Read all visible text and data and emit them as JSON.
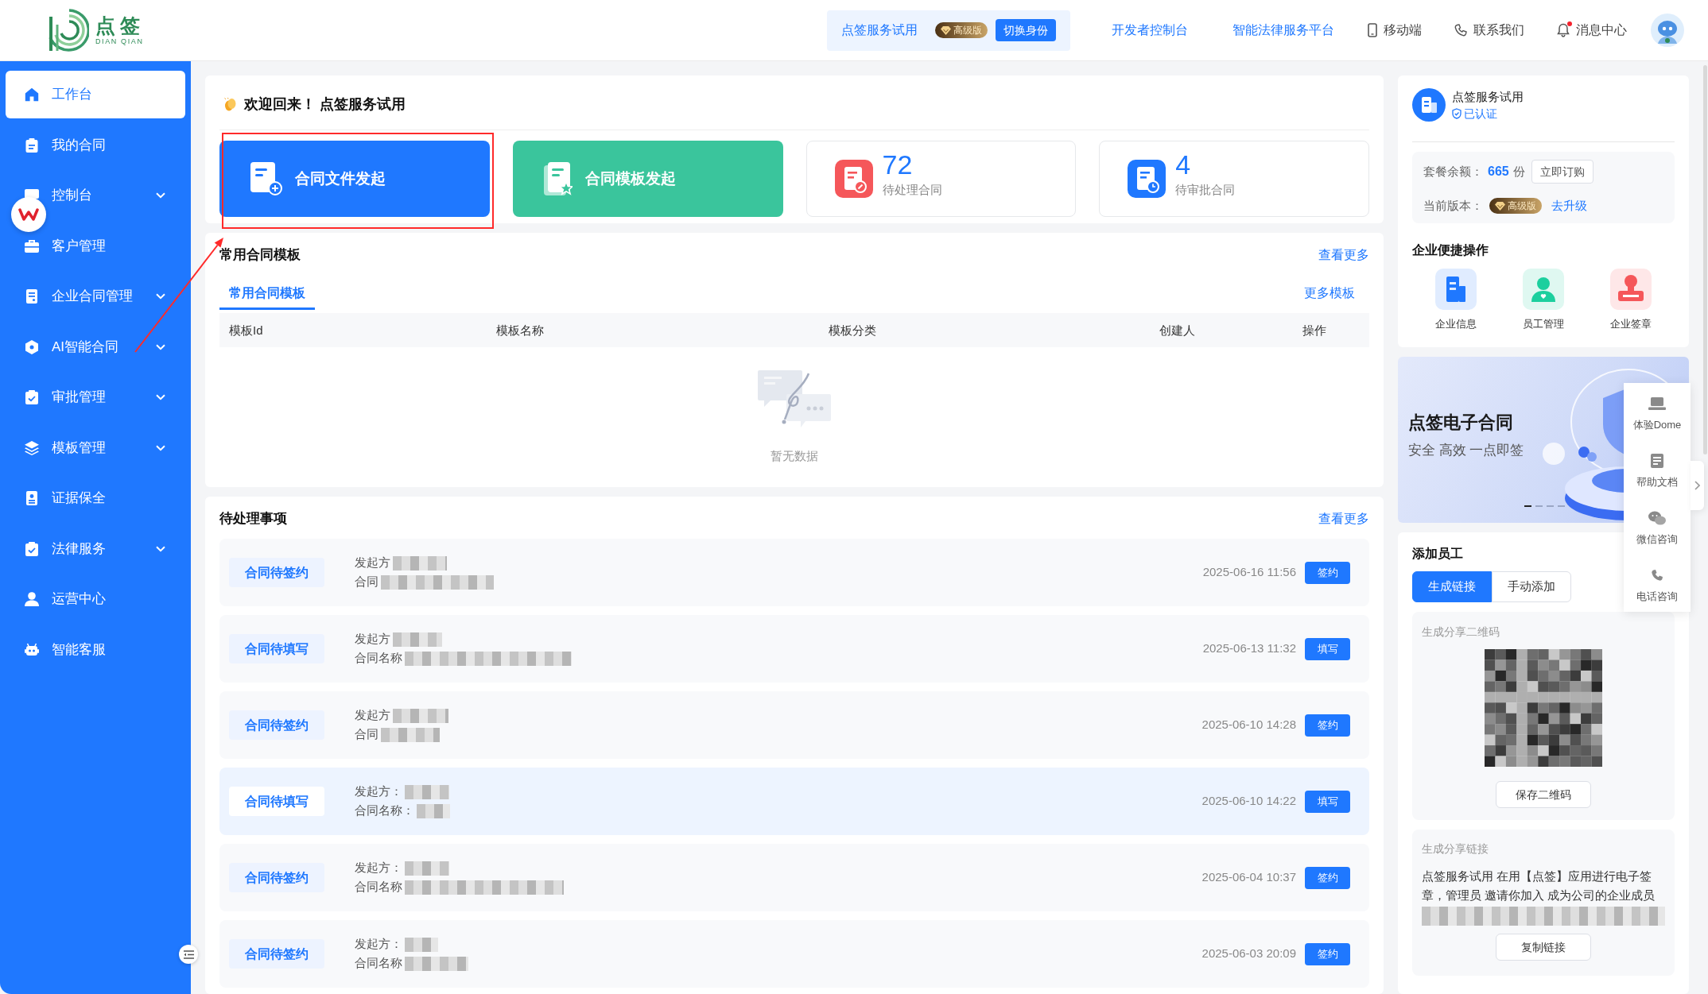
{
  "header": {
    "logo": {
      "name": "点签",
      "subtitle": "DIAN QIAN"
    },
    "identity": {
      "name": "点签服务试用",
      "badge": "高级版",
      "button": "切换身份"
    },
    "links": [
      "开发者控制台",
      "智能法律服务平台"
    ],
    "tools": [
      {
        "label": "移动端",
        "unread": false
      },
      {
        "label": "联系我们",
        "unread": false
      },
      {
        "label": "消息中心",
        "unread": true
      }
    ]
  },
  "sidebar": {
    "items": [
      {
        "label": "工作台",
        "selected": true,
        "expandable": false
      },
      {
        "label": "我的合同",
        "selected": false,
        "expandable": false
      },
      {
        "label": "控制台",
        "selected": false,
        "expandable": true
      },
      {
        "label": "客户管理",
        "selected": false,
        "expandable": false
      },
      {
        "label": "企业合同管理",
        "selected": false,
        "expandable": true
      },
      {
        "label": "AI智能合同",
        "selected": false,
        "expandable": true
      },
      {
        "label": "审批管理",
        "selected": false,
        "expandable": true
      },
      {
        "label": "模板管理",
        "selected": false,
        "expandable": true
      },
      {
        "label": "证据保全",
        "selected": false,
        "expandable": false
      },
      {
        "label": "法律服务",
        "selected": false,
        "expandable": true
      },
      {
        "label": "运营中心",
        "selected": false,
        "expandable": false
      },
      {
        "label": "智能客服",
        "selected": false,
        "expandable": false
      }
    ]
  },
  "welcome": {
    "title": "欢迎回来！ 点签服务试用",
    "actions": [
      {
        "label": "合同文件发起",
        "color": "#1f78ff"
      },
      {
        "label": "合同模板发起",
        "color": "#3ac59c"
      }
    ],
    "stats": [
      {
        "value": "72",
        "label": "待处理合同",
        "color": "#f5575a"
      },
      {
        "value": "4",
        "label": "待审批合同",
        "color": "#1f78ff"
      }
    ]
  },
  "templates": {
    "title": "常用合同模板",
    "more": "查看更多",
    "tabs": [
      {
        "label": "常用合同模板",
        "selected": true
      }
    ],
    "more_templates": "更多模板",
    "columns": [
      "模板Id",
      "模板名称",
      "模板分类",
      "创建人",
      "操作"
    ],
    "empty_text": "暂无数据"
  },
  "pending": {
    "title": "待处理事项",
    "more": "查看更多",
    "rows": [
      {
        "status": "合同待签约",
        "initiator": "发起方",
        "contract": "合同",
        "time": "2025-06-16 11:56",
        "action": "签约",
        "highlighted": false
      },
      {
        "status": "合同待填写",
        "initiator": "发起方",
        "contract": "合同名称",
        "time": "2025-06-13 11:32",
        "action": "填写",
        "highlighted": false
      },
      {
        "status": "合同待签约",
        "initiator": "发起方",
        "contract": "合同",
        "time": "2025-06-10 14:28",
        "action": "签约",
        "highlighted": false
      },
      {
        "status": "合同待填写",
        "initiator": "发起方：",
        "contract": "合同名称：",
        "time": "2025-06-10 14:22",
        "action": "填写",
        "highlighted": true
      },
      {
        "status": "合同待签约",
        "initiator": "发起方：",
        "contract": "合同名称",
        "time": "2025-06-04 10:37",
        "action": "签约",
        "highlighted": false
      },
      {
        "status": "合同待签约",
        "initiator": "发起方：",
        "contract": "合同名称",
        "time": "2025-06-03 20:09",
        "action": "签约",
        "highlighted": false
      }
    ]
  },
  "account": {
    "name": "点签服务试用",
    "verified": "已认证",
    "quota_label": "套餐余额：",
    "quota": "665",
    "quota_unit": "份",
    "buy": "立即订购",
    "version_label": "当前版本：",
    "version": "高级版",
    "upgrade": "去升级"
  },
  "quick_actions": {
    "title": "企业便捷操作",
    "items": [
      {
        "label": "企业信息",
        "color": "#1f78ff"
      },
      {
        "label": "员工管理",
        "color": "#1ccf9e"
      },
      {
        "label": "企业签章",
        "color": "#f5575a"
      }
    ]
  },
  "banner": {
    "title": "点签电子合同",
    "subtitle": "安全 高效 一点即签",
    "indicators": [
      {
        "selected": true
      },
      {
        "selected": false
      },
      {
        "selected": false
      },
      {
        "selected": false
      }
    ]
  },
  "side_toolbar": {
    "items": [
      {
        "label": "体验Dome"
      },
      {
        "label": "帮助文档"
      },
      {
        "label": "微信咨询"
      },
      {
        "label": "电话咨询"
      }
    ]
  },
  "add_staff": {
    "title": "添加员工",
    "tabs": [
      {
        "label": "生成链接",
        "selected": true
      },
      {
        "label": "手动添加",
        "selected": false
      }
    ],
    "qr": {
      "title": "生成分享二维码",
      "button": "保存二维码"
    },
    "link": {
      "title": "生成分享链接",
      "text": "点签服务试用 在用【点签】应用进行电子签章，管理员 邀请你加入 成为公司的企业成员",
      "button": "复制链接"
    }
  }
}
